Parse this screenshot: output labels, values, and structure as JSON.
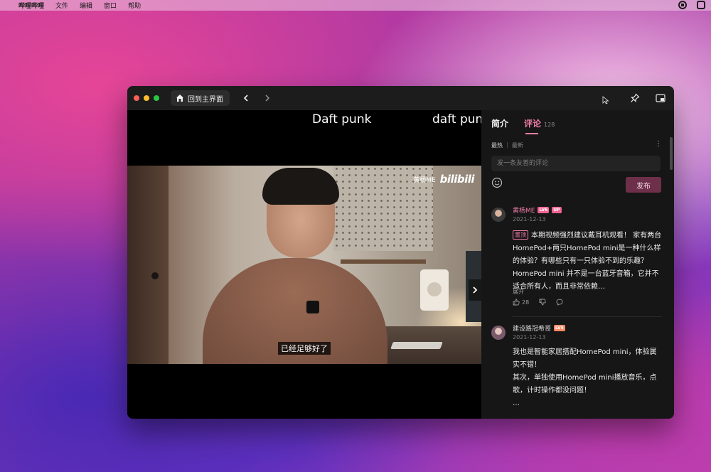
{
  "menubar": {
    "apple": "",
    "app_name": "哔哩哔哩",
    "items": [
      "文件",
      "编辑",
      "窗口",
      "帮助"
    ]
  },
  "titlebar": {
    "home_label": "回到主界面"
  },
  "video": {
    "danmaku": [
      "Daft punk",
      "daft punk"
    ],
    "watermark_user": "黄杨ME",
    "watermark_logo": "bilibili",
    "subtitle": "已经足够好了"
  },
  "panel": {
    "tabs": [
      {
        "label": "简介"
      },
      {
        "label": "评论",
        "count": "128"
      }
    ],
    "sort": {
      "hot": "最热",
      "new": "最新"
    },
    "input_placeholder": "发一条友善的评论",
    "publish_label": "发布",
    "comments": [
      {
        "user": "黄杨ME",
        "level": "LV6",
        "up_badge": "UP",
        "date": "2021-12-13",
        "pin_tag": "置顶",
        "text": "本期视频强烈建议戴耳机观看！ 家有两台HomePod+两只HomePod mini是一种什么样的体验？有哪些只有一只体验不到的乐趣？ HomePod mini 并不是一台蓝牙音箱，它并不适合所有人，而且非常依赖…",
        "expand": "展开",
        "likes": "28"
      },
      {
        "user": "建设路冠希哥",
        "level": "LV5",
        "date": "2021-12-13",
        "text_lines": [
          "我也是智能家居搭配HomePod mini，体验属实不错！",
          "其次，单独使用HomePod mini播放音乐，点歌，计时操作都没问题！",
          "…"
        ],
        "expand": "展开"
      }
    ]
  },
  "colors": {
    "accent_pink": "#f07da8",
    "publish_bg": "#6e2f4a"
  }
}
